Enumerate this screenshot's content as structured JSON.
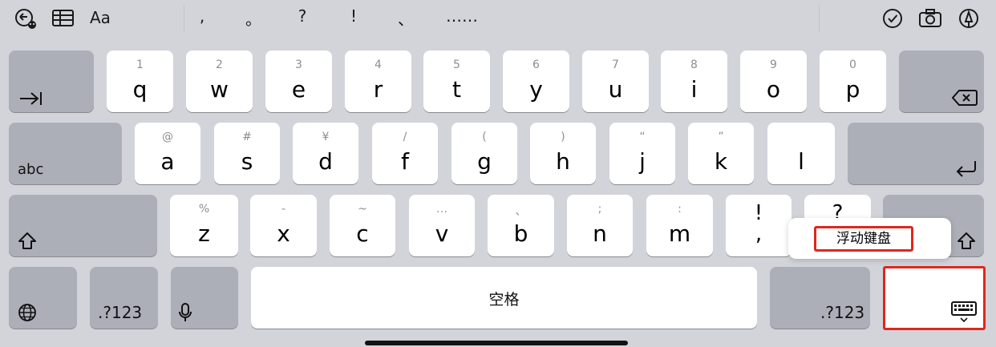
{
  "toolbar": {
    "font_label": "Aa",
    "punctuation": [
      ",",
      "。",
      "?",
      "!",
      "、",
      "……"
    ],
    "icons_left": [
      "undo-emoji-icon",
      "table-icon",
      "font-icon"
    ],
    "icons_right": [
      "checkmark-circle-icon",
      "camera-icon",
      "pen-icon"
    ]
  },
  "rows": {
    "row1": [
      {
        "sec": "1",
        "pri": "q"
      },
      {
        "sec": "2",
        "pri": "w"
      },
      {
        "sec": "3",
        "pri": "e"
      },
      {
        "sec": "4",
        "pri": "r"
      },
      {
        "sec": "5",
        "pri": "t"
      },
      {
        "sec": "6",
        "pri": "y"
      },
      {
        "sec": "7",
        "pri": "u"
      },
      {
        "sec": "8",
        "pri": "i"
      },
      {
        "sec": "9",
        "pri": "o"
      },
      {
        "sec": "0",
        "pri": "p"
      }
    ],
    "row2": [
      {
        "sec": "@",
        "pri": "a"
      },
      {
        "sec": "#",
        "pri": "s"
      },
      {
        "sec": "¥",
        "pri": "d"
      },
      {
        "sec": "/",
        "pri": "f"
      },
      {
        "sec": "(",
        "pri": "g"
      },
      {
        "sec": ")",
        "pri": "h"
      },
      {
        "sec": "“",
        "pri": "j"
      },
      {
        "sec": "”",
        "pri": "k"
      },
      {
        "sec": "",
        "pri": "l"
      }
    ],
    "row3": [
      {
        "sec": "%",
        "pri": "z"
      },
      {
        "sec": "-",
        "pri": "x"
      },
      {
        "sec": "~",
        "pri": "c"
      },
      {
        "sec": "…",
        "pri": "v"
      },
      {
        "sec": "、",
        "pri": "b"
      },
      {
        "sec": ";",
        "pri": "n"
      },
      {
        "sec": ":",
        "pri": "m"
      },
      {
        "sec": "!",
        "pri": ","
      },
      {
        "sec": "?",
        "pri": ""
      }
    ]
  },
  "keys": {
    "abc_label": "abc",
    "numbers_left": ".?123",
    "numbers_right": ".?123",
    "space_label": "空格"
  },
  "popup": {
    "label": "浮动键盘"
  },
  "colors": {
    "highlight": "#e0271c",
    "background": "#d2d4da",
    "dark_key": "#acafb8"
  }
}
